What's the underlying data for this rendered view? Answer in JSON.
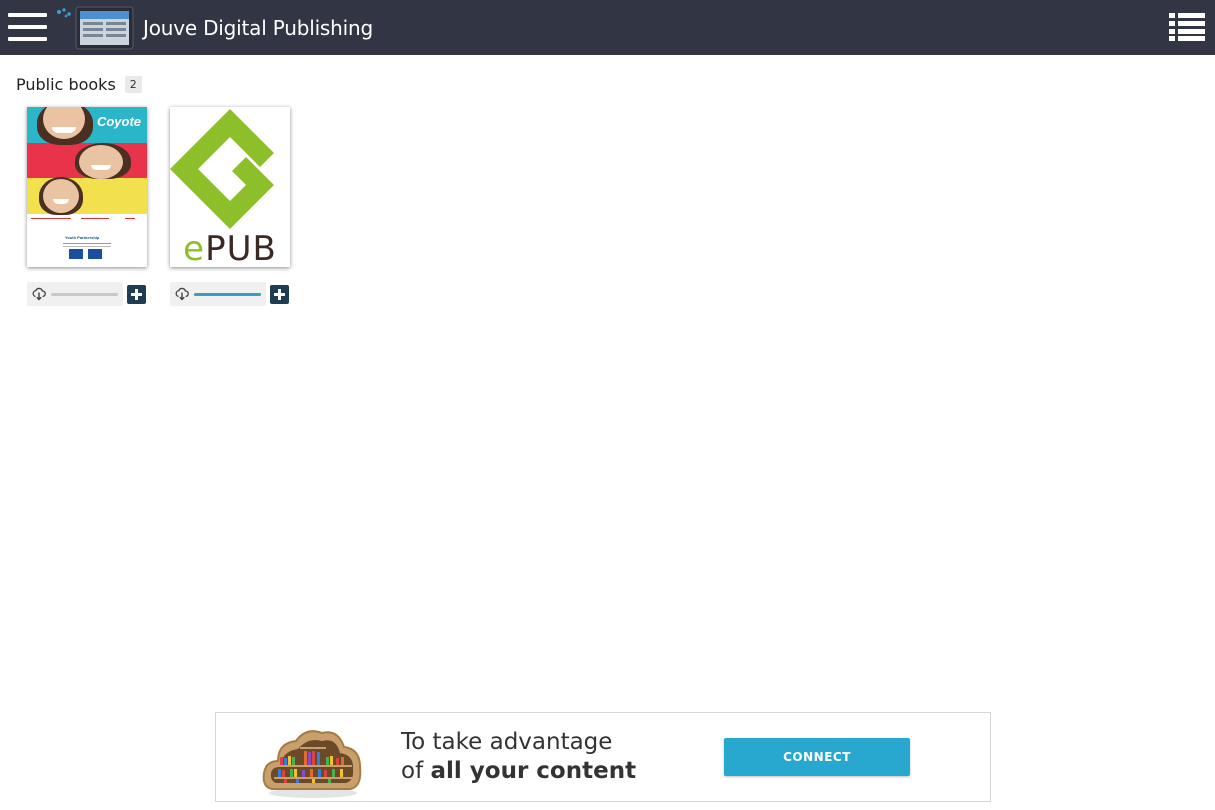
{
  "header": {
    "title": "Jouve Digital Publishing",
    "background": "#323644"
  },
  "library": {
    "section_title": "Public books",
    "count": "2",
    "books": [
      {
        "cover_title": "Coyote",
        "cover_subtitle": "Youth Partnership",
        "download_progress": 0,
        "cover_colors": [
          "#2bb5c8",
          "#e8334a",
          "#f2e14c"
        ]
      },
      {
        "cover_title_prefix": "e",
        "cover_title_rest": "PUB",
        "download_progress": 1,
        "logo_color": "#8cbf2a"
      }
    ]
  },
  "banner": {
    "line1": "To take advantage",
    "line2_prefix": "of ",
    "line2_bold": "all your content",
    "connect_label": "CONNECT",
    "button_color": "#29a8cf"
  }
}
